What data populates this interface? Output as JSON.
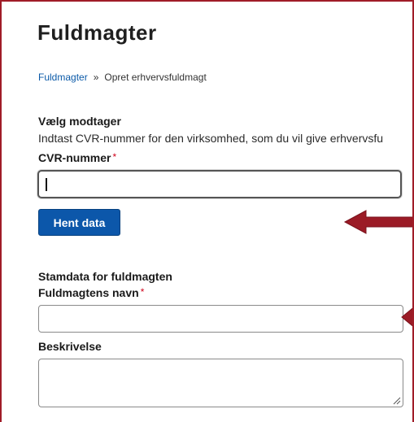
{
  "page": {
    "title": "Fuldmagter"
  },
  "breadcrumb": {
    "parent": "Fuldmagter",
    "separator": "»",
    "current": "Opret erhvervsfuldmagt"
  },
  "recipient": {
    "heading": "Vælg modtager",
    "helper": "Indtast CVR-nummer for den virksomhed, som du vil give erhvervsfu",
    "cvr_label": "CVR-nummer",
    "cvr_value": "",
    "required_marker": "*",
    "fetch_button": "Hent data"
  },
  "master_data": {
    "heading": "Stamdata for fuldmagten",
    "name_label": "Fuldmagtens navn",
    "name_value": "",
    "required_marker": "*",
    "description_label": "Beskrivelse",
    "description_value": ""
  },
  "annotations": {
    "arrow_color": "#9b1b26"
  }
}
